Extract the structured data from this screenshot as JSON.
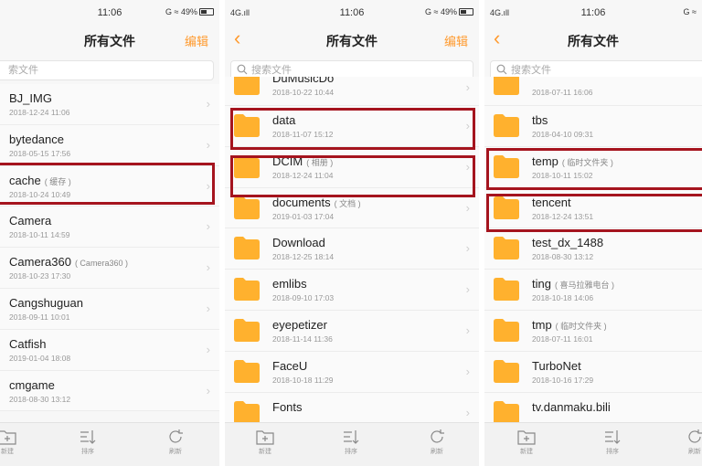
{
  "accent_color": "#ff9a2e",
  "highlight_color": "#a5141e",
  "panels": [
    {
      "status": {
        "left": "",
        "time": "11:06",
        "right": "G ≈ 49%"
      },
      "title": "所有文件",
      "back": "",
      "edit": "编辑",
      "search_placeholder": "索文件",
      "rows": [
        {
          "name": "BJ_IMG",
          "note": "",
          "date": "2018-12-24 11:06"
        },
        {
          "name": "bytedance",
          "note": "",
          "date": "2018-05-15 17:56"
        },
        {
          "name": "cache",
          "note": "( 缓存 )",
          "date": "2018-10-24 10:49"
        },
        {
          "name": "Camera",
          "note": "",
          "date": "2018-10-11 14:59"
        },
        {
          "name": "Camera360",
          "note": "( Camera360 )",
          "date": "2018-10-23 17:30"
        },
        {
          "name": "Cangshuguan",
          "note": "",
          "date": "2018-09-11 10:01"
        },
        {
          "name": "Catfish",
          "note": "",
          "date": "2019-01-04 18:08"
        },
        {
          "name": "cmgame",
          "note": "",
          "date": "2018-08-30 13:12"
        }
      ],
      "toolbar": [
        "新建",
        "排序",
        "刷新"
      ]
    },
    {
      "status": {
        "left": "4G.ıll",
        "time": "11:06",
        "right": "G ≈ 49%"
      },
      "title": "所有文件",
      "back": "‹",
      "edit": "编辑",
      "search_placeholder": "搜索文件",
      "rows": [
        {
          "name": "DuMusicDo",
          "note": "",
          "date": "2018-10-22 10:44"
        },
        {
          "name": "data",
          "note": "",
          "date": "2018-11-07 15:12"
        },
        {
          "name": "DCIM",
          "note": "( 相册 )",
          "date": "2018-12-24 11:04"
        },
        {
          "name": "documents",
          "note": "( 文档 )",
          "date": "2019-01-03 17:04"
        },
        {
          "name": "Download",
          "note": "",
          "date": "2018-12-25 18:14"
        },
        {
          "name": "emlibs",
          "note": "",
          "date": "2018-09-10 17:03"
        },
        {
          "name": "eyepetizer",
          "note": "",
          "date": "2018-11-14 11:36"
        },
        {
          "name": "FaceU",
          "note": "",
          "date": "2018-10-18 11:29"
        },
        {
          "name": "Fonts",
          "note": "",
          "date": ""
        }
      ],
      "toolbar": [
        "新建",
        "排序",
        "刷新"
      ]
    },
    {
      "status": {
        "left": "4G.ıll",
        "time": "11:06",
        "right": "G ≈"
      },
      "title": "所有文件",
      "back": "‹",
      "edit": "",
      "search_placeholder": "搜索文件",
      "rows": [
        {
          "name": "",
          "note": "",
          "date": "2018-07-11 16:06"
        },
        {
          "name": "tbs",
          "note": "",
          "date": "2018-04-10 09:31"
        },
        {
          "name": "temp",
          "note": "( 临时文件夹 )",
          "date": "2018-10-11 15:02"
        },
        {
          "name": "tencent",
          "note": "",
          "date": "2018-12-24 13:51"
        },
        {
          "name": "test_dx_1488",
          "note": "",
          "date": "2018-08-30 13:12"
        },
        {
          "name": "ting",
          "note": "( 喜马拉雅电台 )",
          "date": "2018-10-18 14:06"
        },
        {
          "name": "tmp",
          "note": "( 临时文件夹 )",
          "date": "2018-07-11 16:01"
        },
        {
          "name": "TurboNet",
          "note": "",
          "date": "2018-10-16 17:29"
        },
        {
          "name": "tv.danmaku.bili",
          "note": "",
          "date": ""
        }
      ],
      "toolbar": [
        "新建",
        "排序",
        "刷新"
      ]
    }
  ]
}
